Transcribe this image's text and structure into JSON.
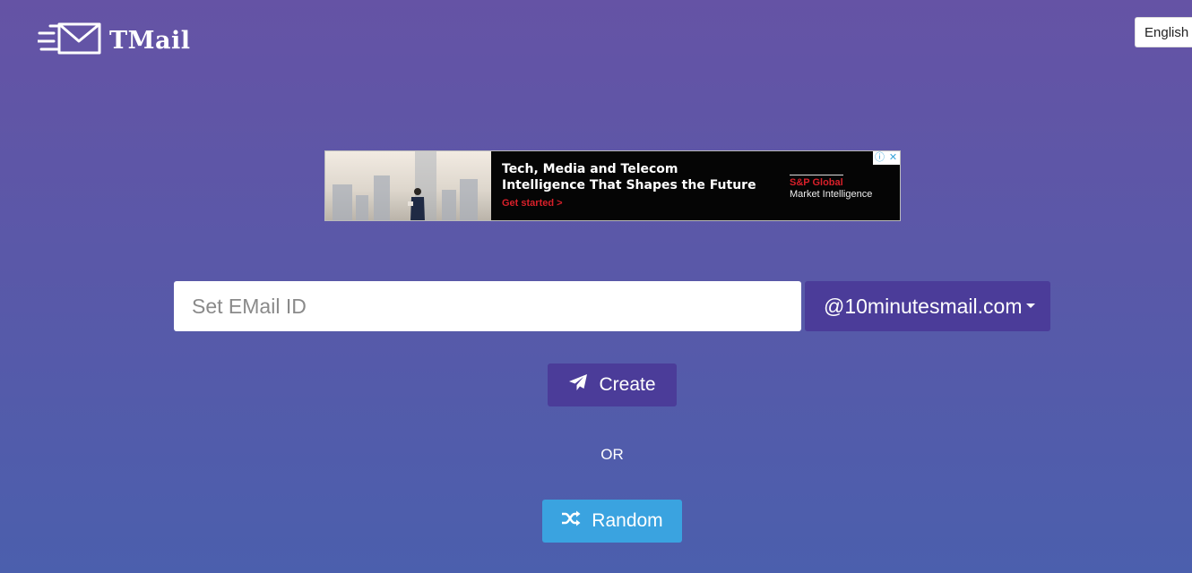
{
  "header": {
    "brand": "TMail",
    "logo_icon": "envelope-speed-icon",
    "language_label": "English"
  },
  "ad": {
    "headline_line1": "Tech, Media and Telecom",
    "headline_line2": "Intelligence That Shapes the Future",
    "cta": "Get started >",
    "brand_name": "S&P Global",
    "brand_sub": "Market Intelligence",
    "info_glyph": "ⓘ",
    "close_glyph": "✕"
  },
  "form": {
    "email_placeholder": "Set EMail ID",
    "email_value": "",
    "domain_selected": "@10minutesmail.com",
    "create_label": "Create",
    "create_icon": "paper-plane-icon",
    "or_label": "OR",
    "random_label": "Random",
    "random_icon": "shuffle-icon"
  },
  "colors": {
    "background_top": "#6553a5",
    "background_bottom": "#4b5fad",
    "primary_button": "#4b3c99",
    "random_button": "#3aa3e0",
    "ad_accent": "#d8202a"
  }
}
